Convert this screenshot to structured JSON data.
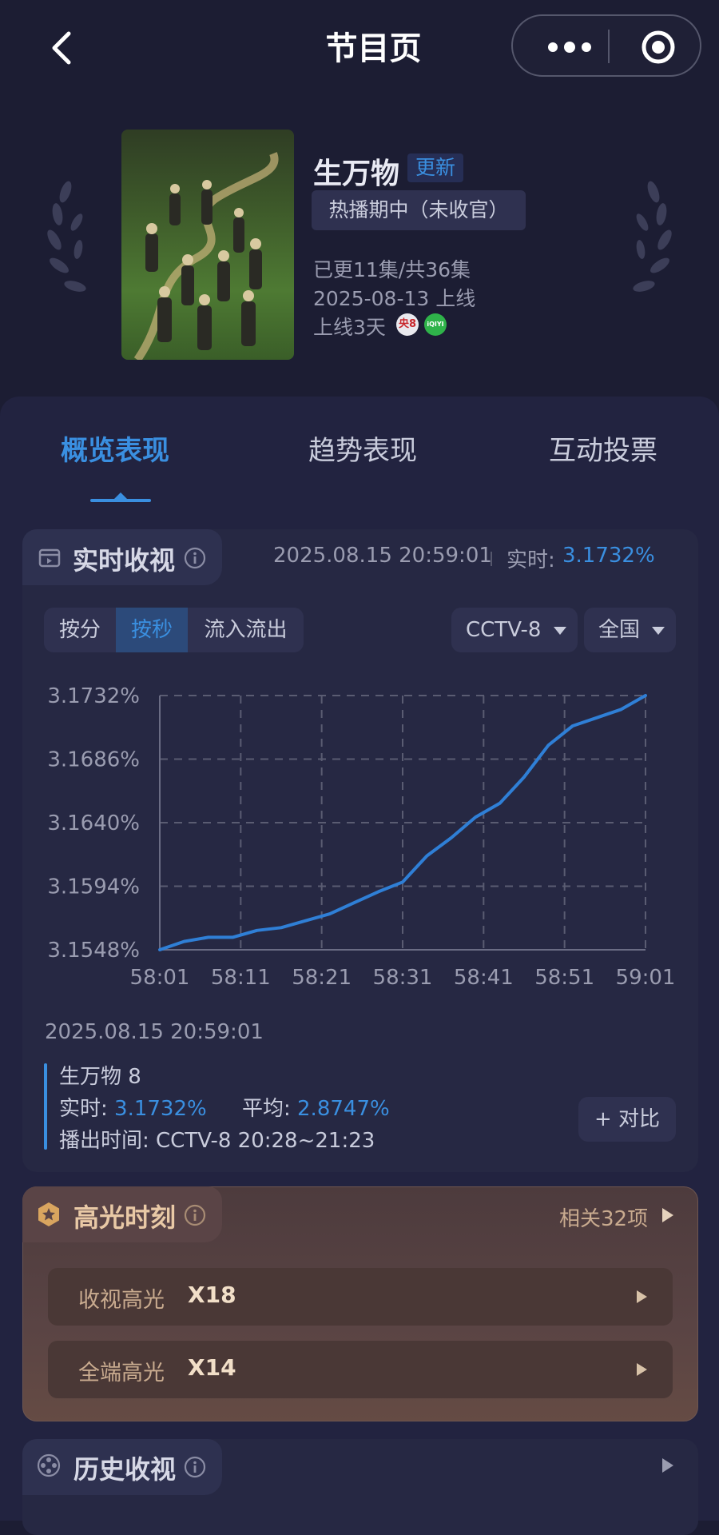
{
  "nav": {
    "title": "节目页",
    "back_icon": "chevron-left-icon",
    "more_icon": "more-dots-icon",
    "target_icon": "target-icon"
  },
  "show": {
    "name": "生万物",
    "update_badge": "更新",
    "status": "热播期中（未收官）",
    "episodes": "已更11集/共36集",
    "release": "2025-08-13 上线",
    "days_online": "上线3天",
    "channel_logos": [
      "央8",
      "iQIYI"
    ]
  },
  "tabs": [
    {
      "label": "概览表现",
      "active": true
    },
    {
      "label": "趋势表现",
      "active": false
    },
    {
      "label": "互动投票",
      "active": false
    }
  ],
  "realtime": {
    "title": "实时收视",
    "timestamp": "2025.08.15 20:59:01",
    "live_label": "实时:",
    "live_value": "3.1732%",
    "segments": [
      "按分",
      "按秒",
      "流入流出"
    ],
    "active_segment": "按秒",
    "channel_select": "CCTV-8",
    "region_select": "全国",
    "detail": {
      "timestamp": "2025.08.15 20:59:01",
      "series_name": "生万物 8",
      "live_label": "实时:",
      "live_value": "3.1732%",
      "avg_label": "平均:",
      "avg_value": "2.8747%",
      "airtime": "播出时间:  CCTV-8 20:28~21:23"
    },
    "compare_button": "+ 对比"
  },
  "chart_data": {
    "type": "line",
    "x": [
      "58:01",
      "58:04",
      "58:07",
      "58:10",
      "58:13",
      "58:16",
      "58:19",
      "58:22",
      "58:25",
      "58:28",
      "58:31",
      "58:34",
      "58:37",
      "58:40",
      "58:43",
      "58:46",
      "58:49",
      "58:52",
      "58:55",
      "58:58",
      "59:01"
    ],
    "y": [
      3.1548,
      3.1554,
      3.1557,
      3.1557,
      3.1562,
      3.1564,
      3.1569,
      3.1574,
      3.1582,
      3.159,
      3.1597,
      3.1616,
      3.1629,
      3.1644,
      3.1654,
      3.1673,
      3.1696,
      3.171,
      3.1716,
      3.1722,
      3.1732
    ],
    "x_ticks": [
      "58:01",
      "58:11",
      "58:21",
      "58:31",
      "58:41",
      "58:51",
      "59:01"
    ],
    "y_ticks": [
      "3.1548%",
      "3.1594%",
      "3.1640%",
      "3.1686%",
      "3.1732%"
    ],
    "ylim": [
      3.1548,
      3.1732
    ],
    "grid": true,
    "line_color": "#2f7fd6"
  },
  "highlights": {
    "title": "高光时刻",
    "more": "相关32项",
    "rows": [
      {
        "label": "收视高光",
        "value": "X18"
      },
      {
        "label": "全端高光",
        "value": "X14"
      }
    ]
  },
  "history": {
    "title": "历史收视"
  },
  "colors": {
    "accent": "#3a8fe0",
    "background": "#1c1d33",
    "highlight_gold": "#e9c9a6"
  }
}
